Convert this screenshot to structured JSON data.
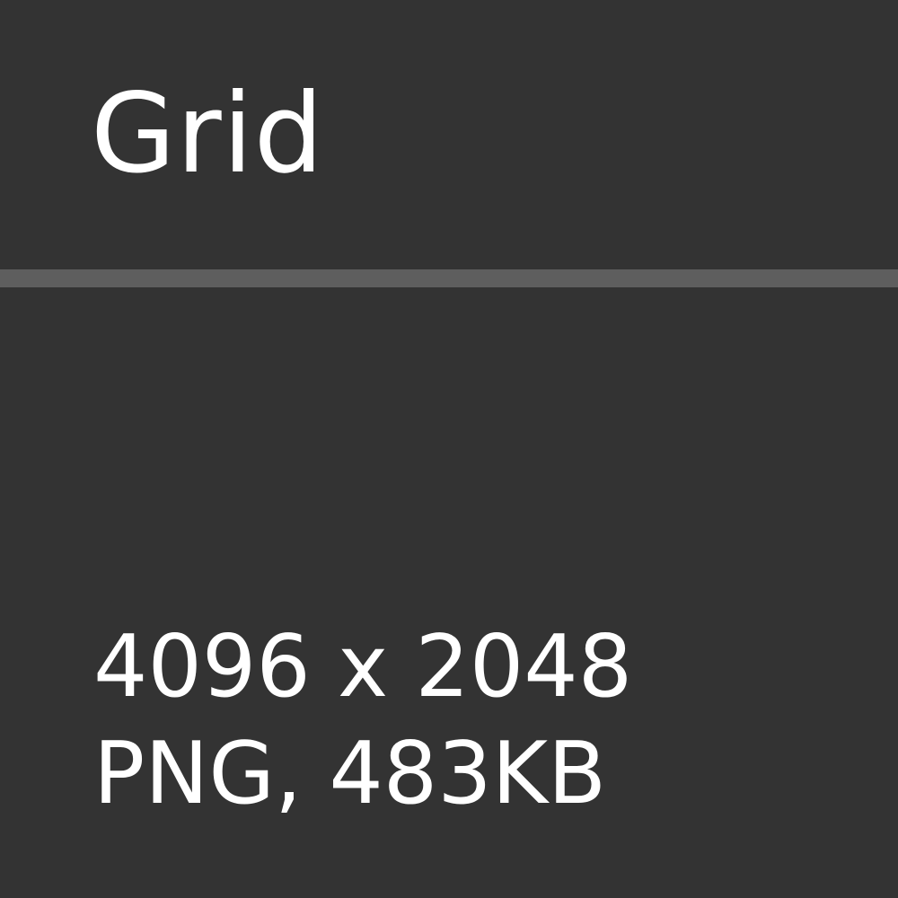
{
  "title": "Grid",
  "dimensions": "4096 x 2048",
  "file_info": "PNG, 483KB",
  "colors": {
    "background": "#333333",
    "divider": "#5e5e5e",
    "text": "#ffffff"
  }
}
